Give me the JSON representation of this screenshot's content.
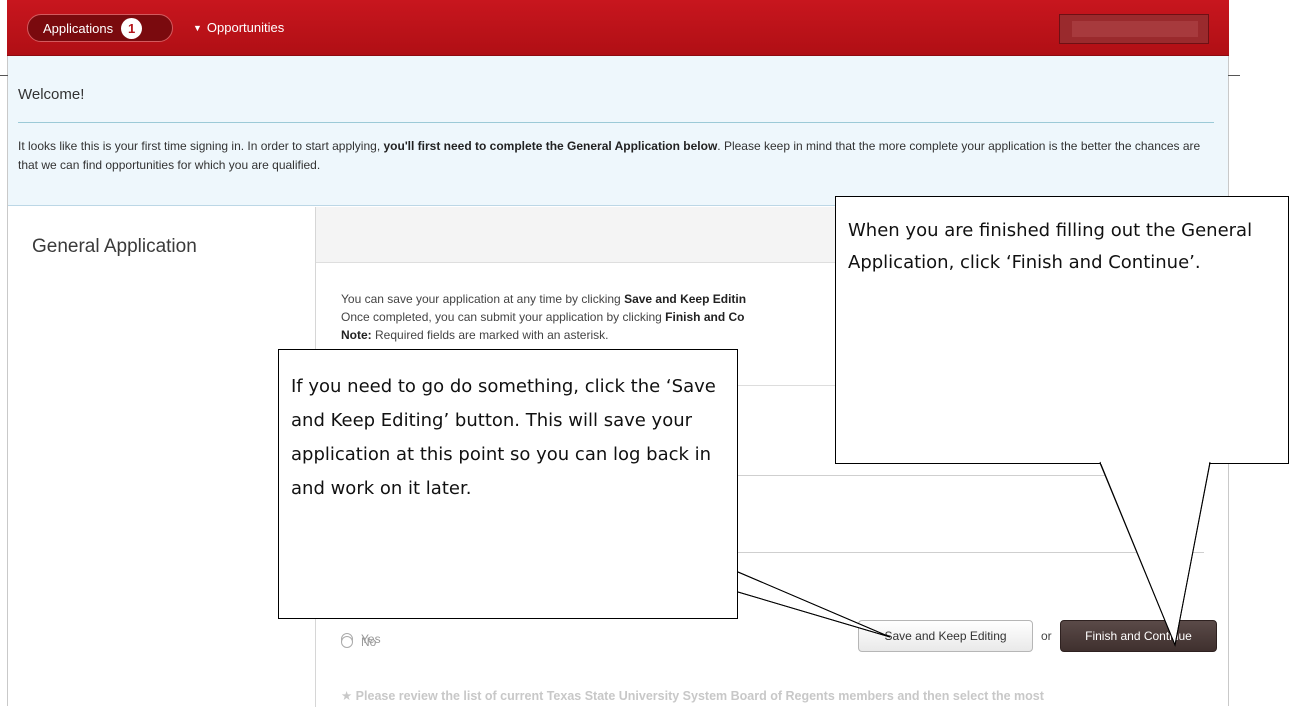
{
  "nav": {
    "applications_label": "Applications",
    "applications_badge": "1",
    "opportunities_label": "Opportunities"
  },
  "welcome": {
    "title": "Welcome!",
    "text_part1": "It looks like this is your first time signing in. In order to start applying, ",
    "text_bold": "you'll first need to complete the General Application below",
    "text_part2": ". Please keep in mind that the more complete your application is the better the chances are that we can find opportunities for which you are qualified."
  },
  "sidebar": {
    "title": "General Application"
  },
  "form": {
    "intro_line1_prefix": "You can save your application at any time by clicking ",
    "intro_line1_bold": "Save and Keep Editin",
    "intro_line2_prefix": "Once completed, you can submit your application by clicking ",
    "intro_line2_bold": "Finish and Co",
    "note_label": "Note:",
    "note_text": " Required fields are marked with an asterisk.",
    "radio_yes": "Yes",
    "radio_no": "No",
    "regents_text": "★ Please review the list of current Texas State University System Board of Regents members and then select the most"
  },
  "buttons": {
    "save_label": "Save and Keep Editing",
    "or_label": "or",
    "finish_label": "Finish and Continue"
  },
  "callouts": {
    "right": "When you are finished filling out the General Application, click ‘Finish and Continue’.",
    "left": "If you need to go do something, click the ‘Save and Keep Editing’ button. This will save your application at this point so you can log back in and work on it later."
  },
  "colors": {
    "top_bar": "#c8161e",
    "welcome_bg": "#eef7fc",
    "finish_button": "#4a3b39"
  }
}
